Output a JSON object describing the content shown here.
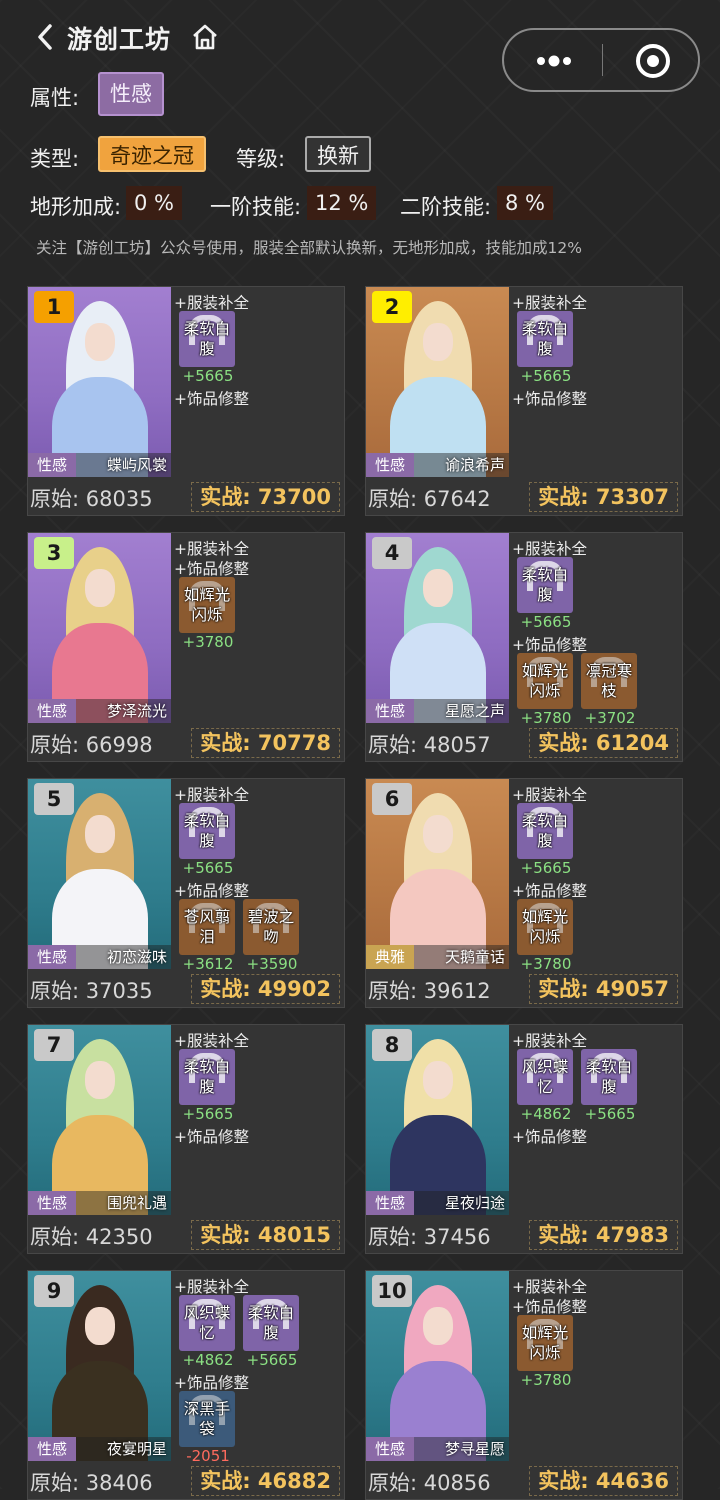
{
  "header": {
    "title": "游创工坊"
  },
  "filters": {
    "attr_label": "属性:",
    "attr_value": "性感",
    "type_label": "类型:",
    "type_value": "奇迹之冠",
    "level_label": "等级:",
    "level_value": "换新",
    "terrain_label": "地形加成:",
    "terrain_value": "0 %",
    "skill1_label": "一阶技能:",
    "skill1_value": "12 %",
    "skill2_label": "二阶技能:",
    "skill2_value": "8 %"
  },
  "note": "关注【游创工坊】公众号使用，服装全部默认换新，无地形加成，技能加成12%",
  "labels": {
    "clothing_fill": "+服装补全",
    "accessory_trim": "+饰品修整",
    "original_prefix": "原始:",
    "actual_prefix": "实战:"
  },
  "colors": {
    "rank1": "#f5a000",
    "rank2": "#ffee00",
    "rank3": "#c8f08a",
    "rank_other": "#c9c9c9",
    "positive": "#8be083",
    "negative": "#ff6b5e",
    "actual": "#f3c35e"
  },
  "cards": [
    {
      "rank": "1",
      "category": "性感",
      "name": "蝶屿风裳",
      "original": "68035",
      "actual": "73700",
      "clothing": [
        {
          "name": "柔软白\n腹",
          "bonus": "+5665"
        }
      ],
      "accessories": []
    },
    {
      "rank": "2",
      "category": "性感",
      "name": "谕浪希声",
      "original": "67642",
      "actual": "73307",
      "clothing": [
        {
          "name": "柔软白\n腹",
          "bonus": "+5665"
        }
      ],
      "accessories": []
    },
    {
      "rank": "3",
      "category": "性感",
      "name": "梦泽流光",
      "original": "66998",
      "actual": "70778",
      "clothing": [],
      "accessories": [
        {
          "name": "如辉光\n闪烁",
          "bonus": "+3780"
        }
      ]
    },
    {
      "rank": "4",
      "category": "性感",
      "name": "星愿之声",
      "original": "48057",
      "actual": "61204",
      "clothing": [
        {
          "name": "柔软白\n腹",
          "bonus": "+5665"
        }
      ],
      "accessories": [
        {
          "name": "如辉光\n闪烁",
          "bonus": "+3780"
        },
        {
          "name": "凛冠寒\n枝",
          "bonus": "+3702"
        }
      ]
    },
    {
      "rank": "5",
      "category": "性感",
      "name": "初恋滋味",
      "original": "37035",
      "actual": "49902",
      "clothing": [
        {
          "name": "柔软白\n腹",
          "bonus": "+5665"
        }
      ],
      "accessories": [
        {
          "name": "苍风翦\n泪",
          "bonus": "+3612"
        },
        {
          "name": "碧波之\n吻",
          "bonus": "+3590"
        }
      ]
    },
    {
      "rank": "6",
      "category": "典雅",
      "name": "天鹅童话",
      "original": "39612",
      "actual": "49057",
      "clothing": [
        {
          "name": "柔软白\n腹",
          "bonus": "+5665"
        }
      ],
      "accessories": [
        {
          "name": "如辉光\n闪烁",
          "bonus": "+3780"
        }
      ]
    },
    {
      "rank": "7",
      "category": "性感",
      "name": "围兜礼遇",
      "original": "42350",
      "actual": "48015",
      "clothing": [
        {
          "name": "柔软白\n腹",
          "bonus": "+5665"
        }
      ],
      "accessories": []
    },
    {
      "rank": "8",
      "category": "性感",
      "name": "星夜归途",
      "original": "37456",
      "actual": "47983",
      "clothing": [
        {
          "name": "风织蝶\n忆",
          "bonus": "+4862"
        },
        {
          "name": "柔软白\n腹",
          "bonus": "+5665"
        }
      ],
      "accessories": []
    },
    {
      "rank": "9",
      "category": "性感",
      "name": "夜宴明星",
      "original": "38406",
      "actual": "46882",
      "clothing": [
        {
          "name": "风织蝶\n忆",
          "bonus": "+4862"
        },
        {
          "name": "柔软白\n腹",
          "bonus": "+5665"
        }
      ],
      "accessories": [
        {
          "name": "深黑手\n袋",
          "bonus": "-2051"
        }
      ]
    },
    {
      "rank": "10",
      "category": "性感",
      "name": "梦寻星愿",
      "original": "40856",
      "actual": "44636",
      "clothing": [],
      "accessories": [
        {
          "name": "如辉光\n闪烁",
          "bonus": "+3780"
        }
      ]
    }
  ]
}
